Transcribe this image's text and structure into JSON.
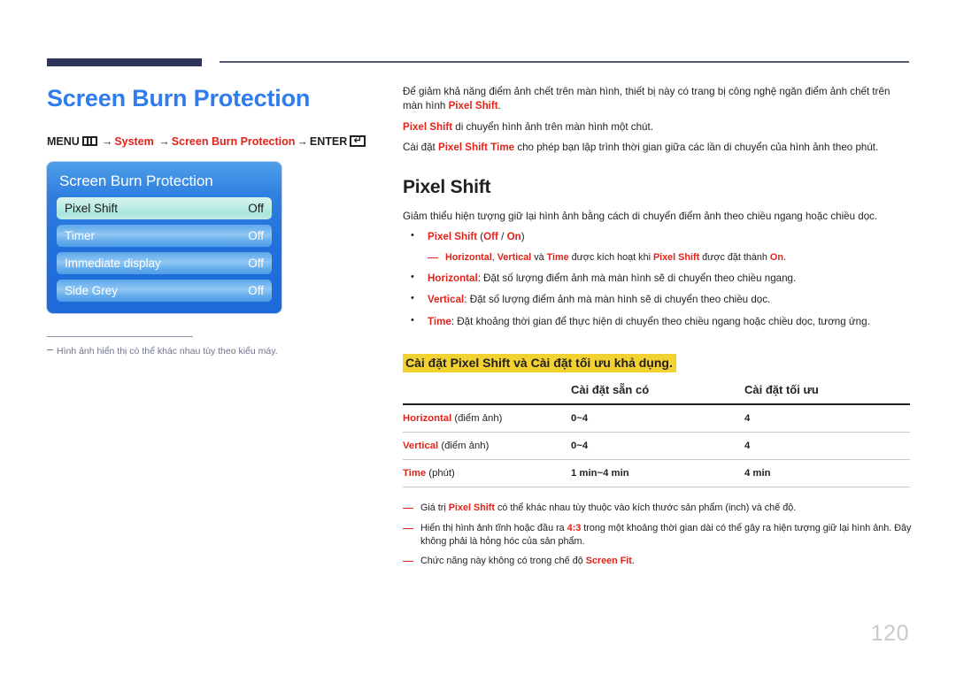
{
  "page": {
    "number": "120"
  },
  "left": {
    "title": "Screen Burn Protection",
    "menu_path": {
      "menu_label": "MENU",
      "menu_icon": "menu-bars-icon",
      "arrow": "→",
      "item1": "System",
      "item2": "Screen Burn Protection",
      "enter_label": "ENTER",
      "enter_icon": "↵"
    },
    "osd": {
      "title": "Screen Burn Protection",
      "rows": [
        {
          "label": "Pixel Shift",
          "value": "Off",
          "selected": true
        },
        {
          "label": "Timer",
          "value": "Off",
          "selected": false
        },
        {
          "label": "Immediate display",
          "value": "Off",
          "selected": false
        },
        {
          "label": "Side Grey",
          "value": "Off",
          "selected": false
        }
      ]
    },
    "note": "Hình ảnh hiển thị có thể khác nhau tùy theo kiểu máy."
  },
  "right": {
    "intro": {
      "p1_a": "Để giảm khả năng điểm ảnh chết trên màn hình, thiết bị này có trang bị công nghệ ngăn điểm ảnh chết trên màn hình ",
      "p1_red": "Pixel Shift",
      "p1_b": ".",
      "p2_red": "Pixel Shift",
      "p2_a": " di chuyển hình ảnh trên màn hình một chút.",
      "p3_a": "Cài đặt ",
      "p3_red": "Pixel Shift Time",
      "p3_b": " cho phép bạn lập trình thời gian giữa các lần di chuyển của hình ảnh theo phút."
    },
    "section_title": "Pixel Shift",
    "section_desc": "Giảm thiểu hiện tượng giữ lại hình ảnh bằng cách di chuyển điểm ảnh theo chiều ngang hoặc chiều dọc.",
    "bullets": [
      {
        "red": "Pixel Shift",
        "rest_a": " (",
        "opt1": "Off",
        "sep": " / ",
        "opt2": "On",
        "rest_b": ")"
      },
      {
        "red": "Horizontal",
        "rest": ": Đặt số lượng điểm ảnh mà màn hình sẽ di chuyển theo chiều ngang."
      },
      {
        "red": "Vertical",
        "rest": ": Đặt số lượng điểm ảnh mà màn hình sẽ di chuyển theo chiều dọc."
      },
      {
        "red": "Time",
        "rest": ": Đặt khoảng thời gian để thực hiện di chuyển theo chiều ngang hoặc chiều dọc, tương ứng."
      }
    ],
    "subnote": {
      "r1": "Horizontal",
      "t1": ", ",
      "r2": "Vertical",
      "t2": " và ",
      "r3": "Time",
      "t3": " được kích hoạt khi ",
      "r4": "Pixel Shift",
      "t4": " được đặt thành ",
      "r5": "On",
      "t5": "."
    },
    "highlight_title": "Cài đặt Pixel Shift và Cài đặt tối ưu khả dụng.",
    "table": {
      "headers": [
        "",
        "Cài đặt sẵn có",
        "Cài đặt tối ưu"
      ],
      "rows": [
        {
          "label_red": "Horizontal",
          "label_rest": " (điểm ảnh)",
          "available": "0~4",
          "optimum": "4"
        },
        {
          "label_red": "Vertical",
          "label_rest": " (điểm ảnh)",
          "available": "0~4",
          "optimum": "4"
        },
        {
          "label_red": "Time",
          "label_rest": " (phút)",
          "available": "1 min~4 min",
          "optimum": "4 min"
        }
      ]
    },
    "footnotes": [
      {
        "a": "Giá trị ",
        "red": "Pixel Shift",
        "b": " có thể khác nhau tùy thuộc vào kích thước sản phẩm (inch) và chế độ."
      },
      {
        "a": "Hiển thị hình ảnh tĩnh hoặc đầu ra ",
        "red": "4:3",
        "b": " trong một khoảng thời gian dài có thể gây ra hiện tượng giữ lại hình ảnh. Đây không phải là hỏng hóc của sản phẩm."
      },
      {
        "a": "Chức năng này không có trong chế độ ",
        "red": "Screen Fit",
        "b": "."
      }
    ]
  }
}
